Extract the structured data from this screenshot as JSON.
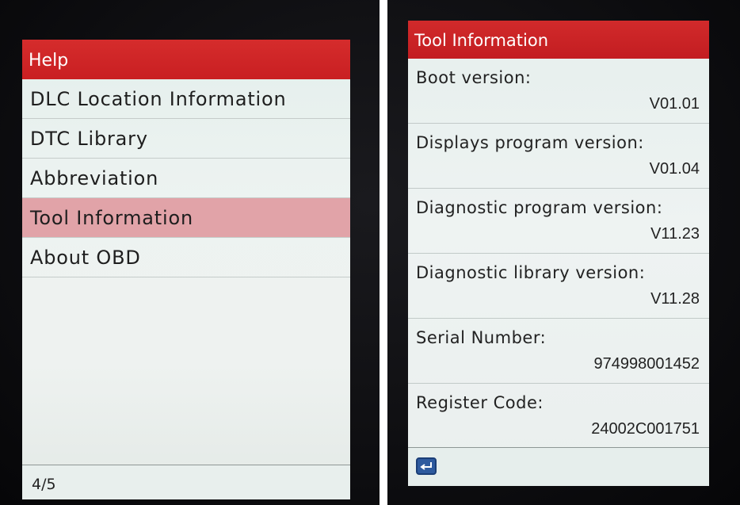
{
  "left_screen": {
    "title": "Help",
    "menu_items": [
      {
        "label": "DLC Location Information",
        "selected": false
      },
      {
        "label": "DTC Library",
        "selected": false
      },
      {
        "label": "Abbreviation",
        "selected": false
      },
      {
        "label": "Tool Information",
        "selected": true
      },
      {
        "label": "About OBD",
        "selected": false
      }
    ],
    "page_indicator": "4/5"
  },
  "right_screen": {
    "title": "Tool Information",
    "rows": [
      {
        "label": "Boot version:",
        "value": "V01.01"
      },
      {
        "label": "Displays program version:",
        "value": "V01.04"
      },
      {
        "label": "Diagnostic program version:",
        "value": "V11.23"
      },
      {
        "label": "Diagnostic library version:",
        "value": "V11.28"
      },
      {
        "label": "Serial Number:",
        "value": "974998001452"
      },
      {
        "label": "Register Code:",
        "value": "24002C001751"
      }
    ],
    "back_icon": "return-arrow-icon"
  },
  "colors": {
    "title_bar": "#cc2326",
    "selected_row": "#e1a3a8",
    "screen_bg": "#edf3f1",
    "back_button": "#2e5a9e"
  }
}
